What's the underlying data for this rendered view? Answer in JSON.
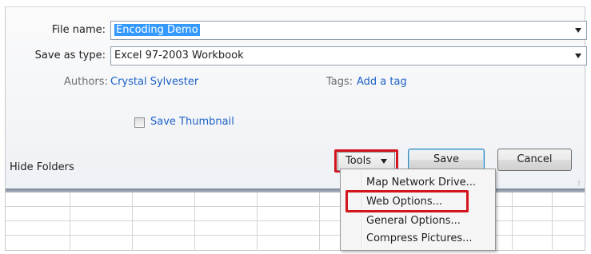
{
  "form": {
    "file_name_label": "File name:",
    "file_name_value": "Encoding Demo",
    "save_as_type_label": "Save as type:",
    "save_as_type_value": "Excel 97-2003 Workbook",
    "authors_label": "Authors:",
    "authors_value": "Crystal Sylvester",
    "tags_label": "Tags:",
    "tags_value": "Add a tag",
    "thumbnail_label": "Save Thumbnail",
    "thumbnail_checked": false
  },
  "footer": {
    "hide_folders_label": "Hide Folders",
    "tools_label": "Tools",
    "save_label": "Save",
    "cancel_label": "Cancel"
  },
  "tools_menu": {
    "items": [
      {
        "label": "Map Network Drive..."
      },
      {
        "label": "Web Options..."
      },
      {
        "label": "General Options..."
      },
      {
        "label": "Compress Pictures..."
      }
    ],
    "highlighted_item": "Web Options..."
  },
  "colors": {
    "highlight_box": "#d2141c",
    "link": "#1e62c7",
    "selection": "#3399ff"
  }
}
